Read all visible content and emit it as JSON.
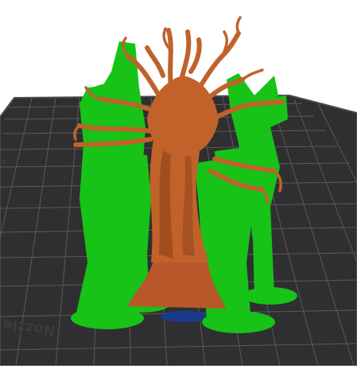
{
  "viewport": {
    "bed_label": "Nozzle only area",
    "edge_letter": "a"
  },
  "colors": {
    "background": "#ffffff",
    "bed_surface": "#2f2f31",
    "bed_rim": "#3b3b3d",
    "grid_line": "#5b5b5e",
    "support_material": "#17c317",
    "model_material": "#c0622a",
    "model_shadow": "#8c3f17",
    "base_plate": "#1a3a8a"
  },
  "objects": [
    {
      "name": "tree-model",
      "material": "model"
    },
    {
      "name": "support-structures",
      "material": "support"
    }
  ]
}
